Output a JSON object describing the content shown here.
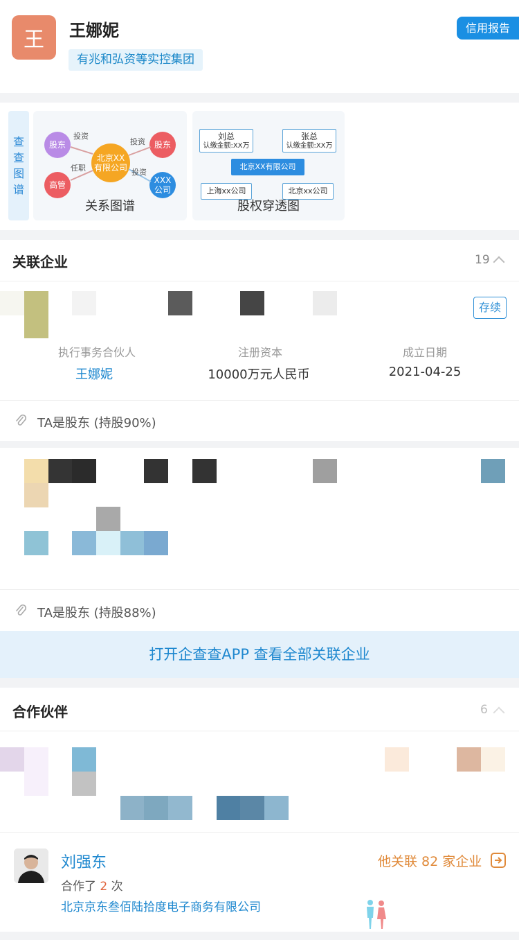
{
  "header": {
    "avatar_char": "王",
    "name": "王娜妮",
    "group_tag": "有兆和弘资等实控集团",
    "credit_button": "信用报告"
  },
  "graphs": {
    "side_label": [
      "查",
      "查",
      "图",
      "谱"
    ],
    "relation": {
      "label": "关系图谱",
      "center": "北京XX\n有限公司",
      "nodes": {
        "shareholder": "股东",
        "executive": "高管",
        "shareholder2": "股东",
        "company": "XXX\n公司"
      },
      "edges": {
        "invest1": "投资",
        "appointed": "任职",
        "invest2": "投资",
        "invest3": "投资"
      }
    },
    "equity": {
      "label": "股权穿透图",
      "top_left": {
        "name": "刘总",
        "amount": "认缴金额:XX万"
      },
      "top_right": {
        "name": "张总",
        "amount": "认缴金额:XX万"
      },
      "center": "北京XX有限公司",
      "bottom_left": "上海xx公司",
      "bottom_right": "北京xx公司"
    }
  },
  "related": {
    "title": "关联企业",
    "count": "19",
    "item1": {
      "status": "存续",
      "labels": [
        "执行事务合伙人",
        "注册资本",
        "成立日期"
      ],
      "values": [
        "王娜妮",
        "10000万元人民币",
        "2021-04-25"
      ],
      "shareholder": "TA是股东 (持股90%)"
    },
    "item2": {
      "shareholder": "TA是股东 (持股88%)"
    },
    "open_app": "打开企查查APP 查看全部关联企业"
  },
  "partners": {
    "title": "合作伙伴",
    "count": "6",
    "partner": {
      "name": "刘强东",
      "coop_prefix": "合作了",
      "coop_num": "2",
      "coop_suffix": "次",
      "company": "北京京东叁佰陆拾度电子商务有限公司",
      "related_text": "他关联 82 家企业"
    }
  },
  "colors": {
    "accent": "#1a8fe3",
    "link": "#1f88cf",
    "orange": "#e08a3a"
  }
}
